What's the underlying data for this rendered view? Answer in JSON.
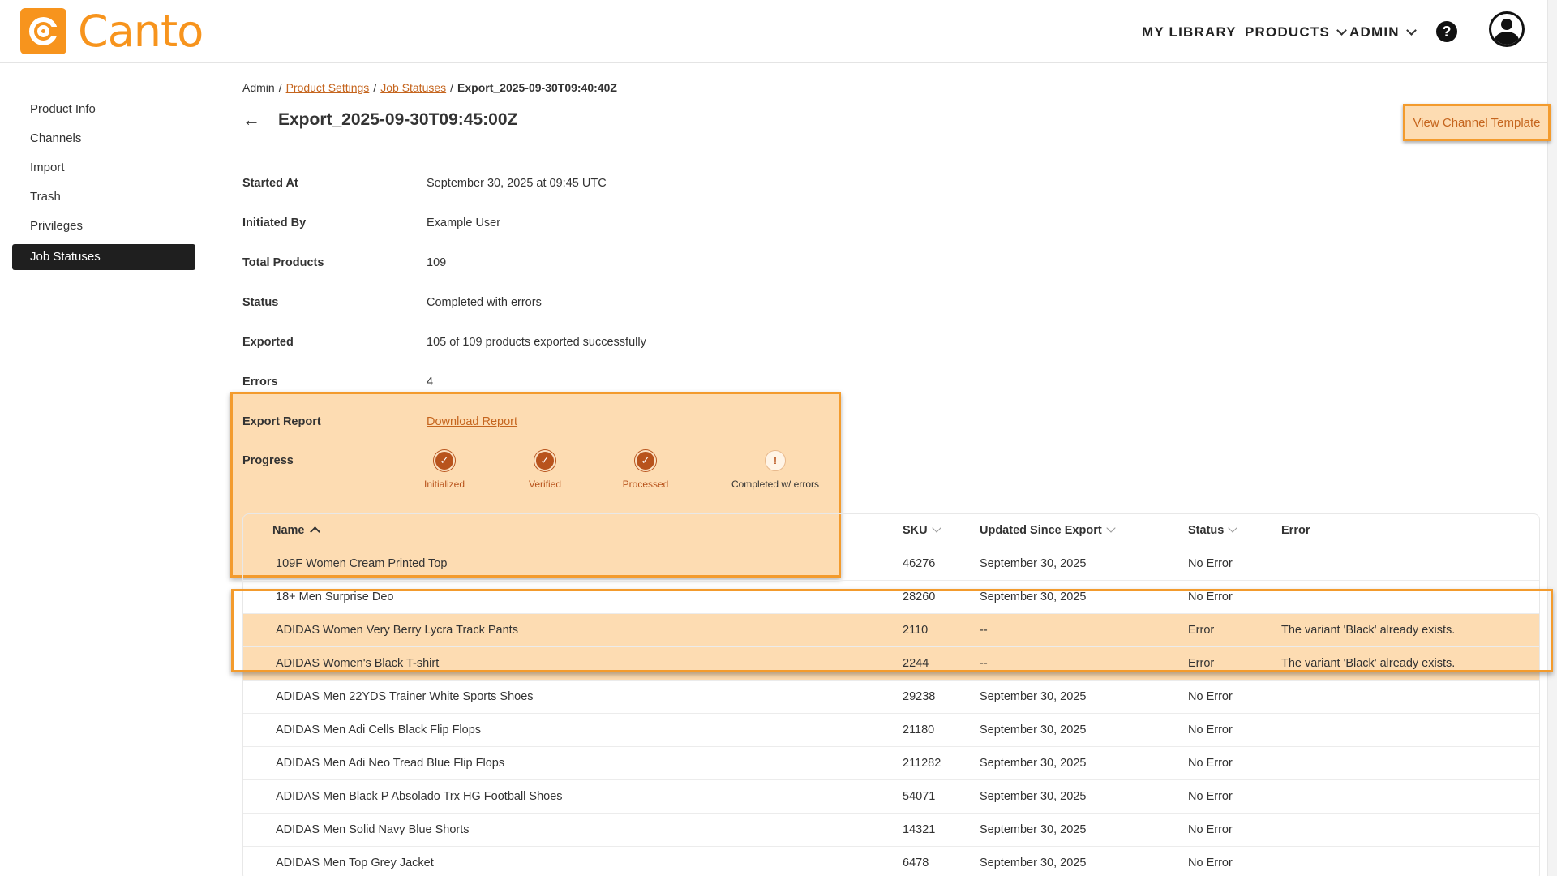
{
  "app": {
    "name": "Canto",
    "brand_color": "#f7941d",
    "accent_color": "#c5651e",
    "highlight_color": "#fddcb2"
  },
  "header": {
    "nav": [
      {
        "label": "MY LIBRARY"
      },
      {
        "label": "PRODUCTS"
      },
      {
        "label": "ADMIN"
      }
    ],
    "help_label": "?",
    "help_icon": "help-icon",
    "avatar_icon": "user-avatar-icon"
  },
  "sidebar": {
    "items": [
      {
        "label": "Product Info"
      },
      {
        "label": "Channels"
      },
      {
        "label": "Import"
      },
      {
        "label": "Trash"
      },
      {
        "label": "Privileges"
      },
      {
        "label": "Job Statuses",
        "active": true
      }
    ]
  },
  "breadcrumb": {
    "root": "Admin",
    "sep": "/",
    "links": [
      "Product Settings",
      "Job Statuses"
    ],
    "current": "Export_2025-09-30T09:40:40Z"
  },
  "page": {
    "title": "Export_2025-09-30T09:45:00Z",
    "back_icon": "arrow-left-icon",
    "view_template_label": "View Channel Template"
  },
  "details": {
    "started_at": {
      "label": "Started At",
      "value": "September 30, 2025 at 09:45 UTC"
    },
    "initiated_by": {
      "label": "Initiated By",
      "value": "Example User"
    },
    "total_products": {
      "label": "Total Products",
      "value": "109"
    },
    "status": {
      "label": "Status",
      "value": "Completed with errors"
    },
    "exported": {
      "label": "Exported",
      "value": "105 of 109 products exported successfully"
    },
    "errors": {
      "label": "Errors",
      "value": "4"
    },
    "export_report": {
      "label": "Export Report",
      "value": "Download Report"
    },
    "progress": {
      "label": "Progress",
      "steps": [
        {
          "label": "Initialized",
          "state": "done",
          "glyph": "✓"
        },
        {
          "label": "Verified",
          "state": "done",
          "glyph": "✓"
        },
        {
          "label": "Processed",
          "state": "done",
          "glyph": "✓"
        },
        {
          "label": "Completed w/ errors",
          "state": "error",
          "glyph": "!"
        }
      ]
    }
  },
  "table": {
    "columns": {
      "name": "Name",
      "sku": "SKU",
      "updated": "Updated Since Export",
      "status": "Status",
      "error": "Error"
    },
    "rows": [
      {
        "name": "109F Women Cream Printed Top",
        "sku": "46276",
        "updated": "September 30, 2025",
        "status": "No Error",
        "error": ""
      },
      {
        "name": "18+ Men Surprise Deo",
        "sku": "28260",
        "updated": "September 30, 2025",
        "status": "No Error",
        "error": ""
      },
      {
        "name": "ADIDAS Women Very Berry Lycra Track Pants",
        "sku": "2110",
        "updated": "--",
        "status": "Error",
        "error": "The variant 'Black' already exists."
      },
      {
        "name": "ADIDAS Women's Black T-shirt",
        "sku": "2244",
        "updated": "--",
        "status": "Error",
        "error": "The variant 'Black' already exists."
      },
      {
        "name": "ADIDAS Men 22YDS Trainer White Sports Shoes",
        "sku": "29238",
        "updated": "September 30, 2025",
        "status": "No Error",
        "error": ""
      },
      {
        "name": "ADIDAS Men Adi Cells Black Flip Flops",
        "sku": "21180",
        "updated": "September 30, 2025",
        "status": "No Error",
        "error": ""
      },
      {
        "name": "ADIDAS Men Adi Neo Tread Blue Flip Flops",
        "sku": "211282",
        "updated": "September 30, 2025",
        "status": "No Error",
        "error": ""
      },
      {
        "name": "ADIDAS Men Black P Absolado Trx HG Football Shoes",
        "sku": "54071",
        "updated": "September 30, 2025",
        "status": "No Error",
        "error": ""
      },
      {
        "name": "ADIDAS Men Solid Navy Blue Shorts",
        "sku": "14321",
        "updated": "September 30, 2025",
        "status": "No Error",
        "error": ""
      },
      {
        "name": "ADIDAS Men Top Grey Jacket",
        "sku": "6478",
        "updated": "September 30, 2025",
        "status": "No Error",
        "error": ""
      }
    ]
  }
}
